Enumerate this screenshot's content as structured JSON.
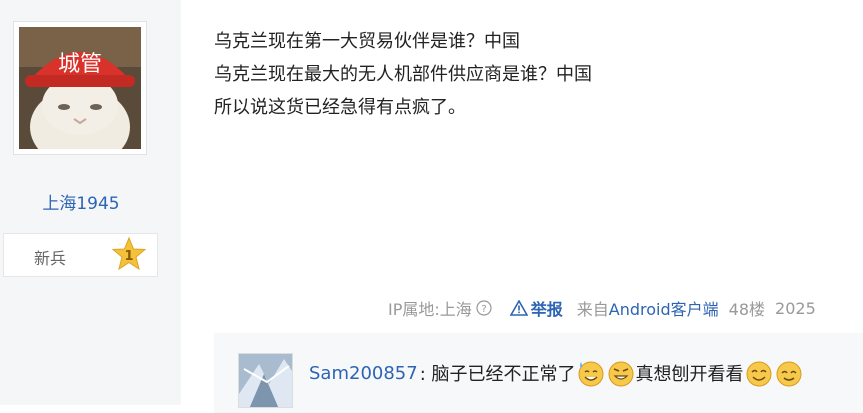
{
  "user": {
    "name": "上海1945",
    "level_title": "新兵",
    "level_number": "1",
    "avatar_text": "城管"
  },
  "post": {
    "lines": [
      "乌克兰现在第一大贸易伙伴是谁？中国",
      "乌克兰现在最大的无人机部件供应商是谁？中国",
      "所以说这货已经急得有点疯了。"
    ]
  },
  "meta": {
    "ip_location": "IP属地:上海",
    "report_label": "举报",
    "client_prefix": "来自",
    "client_name": "Android客户端",
    "floor": "48楼",
    "date": "2025"
  },
  "comment": {
    "username": "Sam200857",
    "text_before": ": 脑子已经不正常了",
    "text_after": "真想刨开看看"
  },
  "colors": {
    "link": "#2d64b3",
    "sidebar_bg": "#f5f6f8",
    "comment_bg": "#f7f8fa",
    "badge": "#f4c23a"
  }
}
